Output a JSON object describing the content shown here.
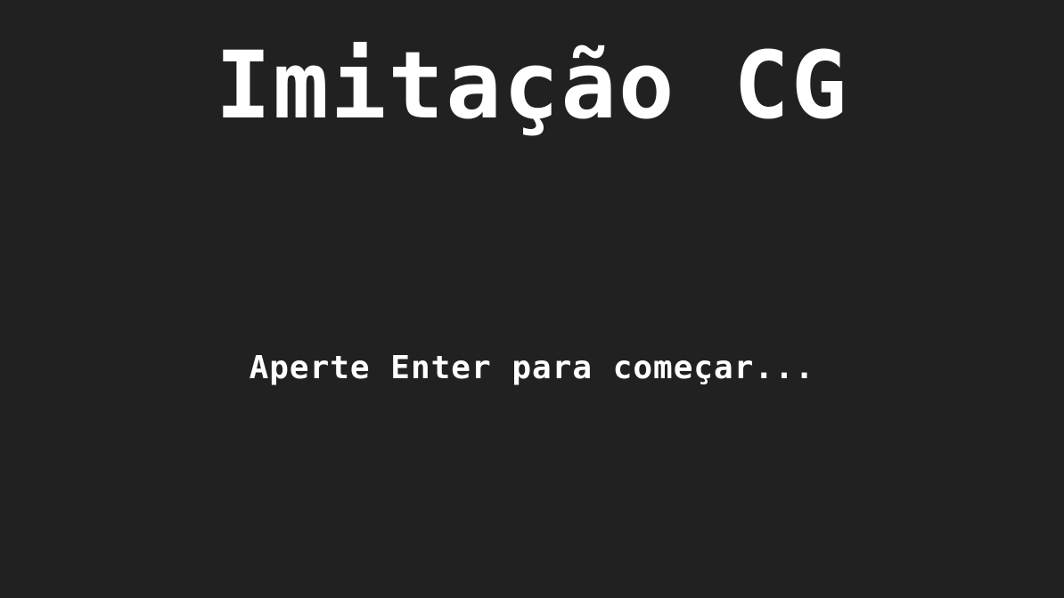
{
  "game": {
    "title": "Imitação CG",
    "start_prompt": "Aperte Enter para começar..."
  },
  "colors": {
    "background": "#212121",
    "text": "#ffffff",
    "reflection": "#8c8c8c"
  }
}
